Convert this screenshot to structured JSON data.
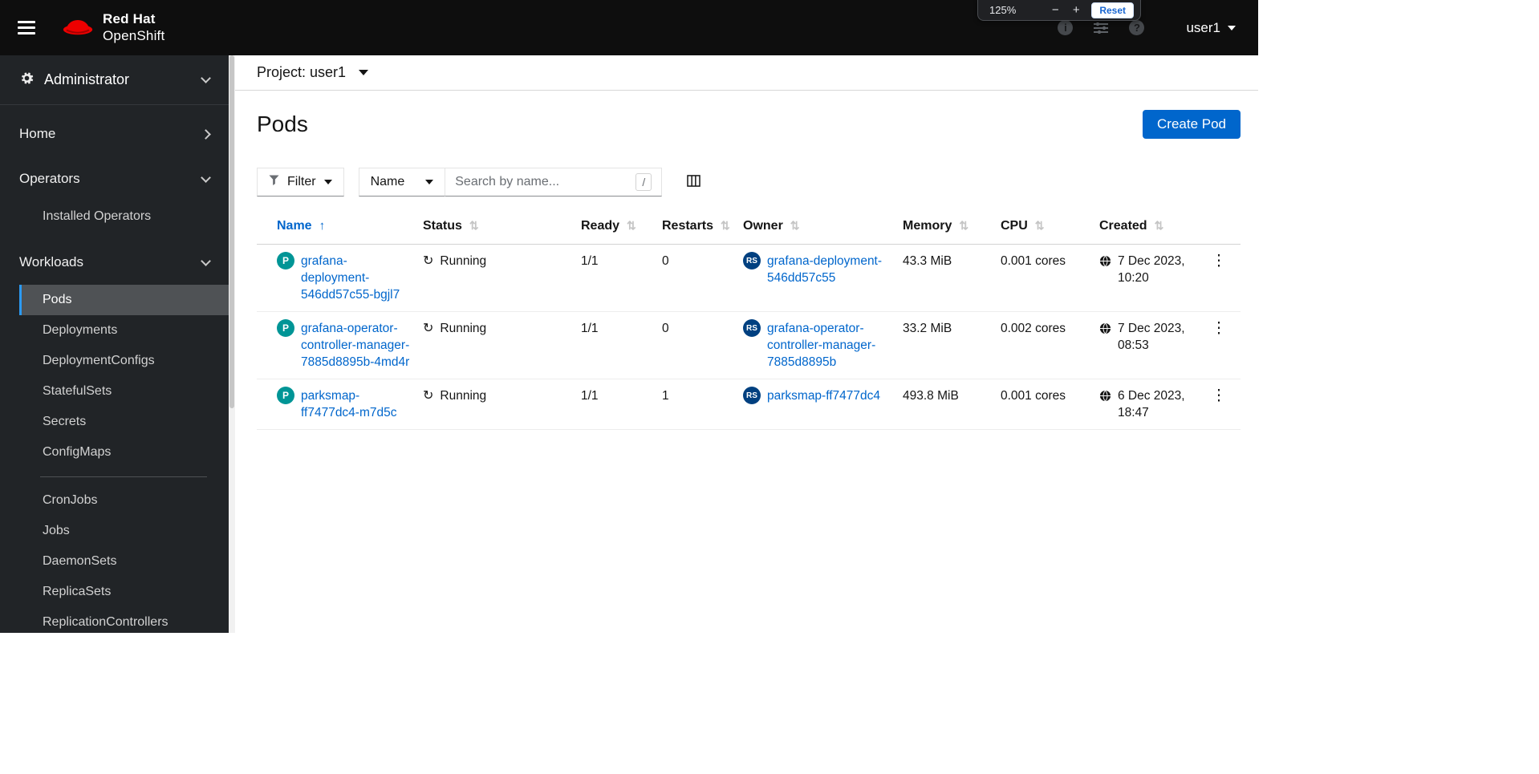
{
  "masthead": {
    "brand_line1": "Red Hat",
    "brand_line2": "OpenShift",
    "user": "user1",
    "zoom": {
      "level": "125%",
      "minus": "−",
      "plus": "+",
      "reset": "Reset"
    }
  },
  "sidebar": {
    "perspective": "Administrator",
    "home": "Home",
    "operators": "Operators",
    "operators_children": [
      "Installed Operators"
    ],
    "workloads": "Workloads",
    "workloads_children": [
      "Pods",
      "Deployments",
      "DeploymentConfigs",
      "StatefulSets",
      "Secrets",
      "ConfigMaps",
      "CronJobs",
      "Jobs",
      "DaemonSets",
      "ReplicaSets",
      "ReplicationControllers"
    ],
    "selected": "Pods"
  },
  "project_bar": {
    "label": "Project: user1"
  },
  "page": {
    "title": "Pods",
    "create_button": "Create Pod"
  },
  "toolbar": {
    "filter_label": "Filter",
    "name_label": "Name",
    "search_placeholder": "Search by name...",
    "search_value": "",
    "shortcut_hint": "/"
  },
  "table": {
    "headers": {
      "name": "Name",
      "status": "Status",
      "ready": "Ready",
      "restarts": "Restarts",
      "owner": "Owner",
      "memory": "Memory",
      "cpu": "CPU",
      "created": "Created"
    },
    "sort": {
      "column": "Name",
      "direction": "ascending"
    },
    "rows": [
      {
        "badge": "P",
        "name": "grafana-deployment-546dd57c55-bgjl7",
        "status": "Running",
        "ready": "1/1",
        "restarts": "0",
        "owner_badge": "RS",
        "owner": "grafana-deployment-546dd57c55",
        "memory": "43.3 MiB",
        "cpu": "0.001 cores",
        "created": "7 Dec 2023, 10:20"
      },
      {
        "badge": "P",
        "name": "grafana-operator-controller-manager-7885d8895b-4md4r",
        "status": "Running",
        "ready": "1/1",
        "restarts": "0",
        "owner_badge": "RS",
        "owner": "grafana-operator-controller-manager-7885d8895b",
        "memory": "33.2 MiB",
        "cpu": "0.002 cores",
        "created": "7 Dec 2023, 08:53"
      },
      {
        "badge": "P",
        "name": "parksmap-ff7477dc4-m7d5c",
        "status": "Running",
        "ready": "1/1",
        "restarts": "1",
        "owner_badge": "RS",
        "owner": "parksmap-ff7477dc4",
        "memory": "493.8 MiB",
        "cpu": "0.001 cores",
        "created": "6 Dec 2023, 18:47"
      }
    ]
  },
  "colors": {
    "accent_blue": "#0066cc",
    "pod_badge": "#009596",
    "replicaset_badge": "#004080",
    "nav_selected_bg": "#4f5255",
    "nav_active_border": "#2b9af3",
    "masthead_bg": "#0e0e0e",
    "sidebar_bg": "#212427"
  }
}
